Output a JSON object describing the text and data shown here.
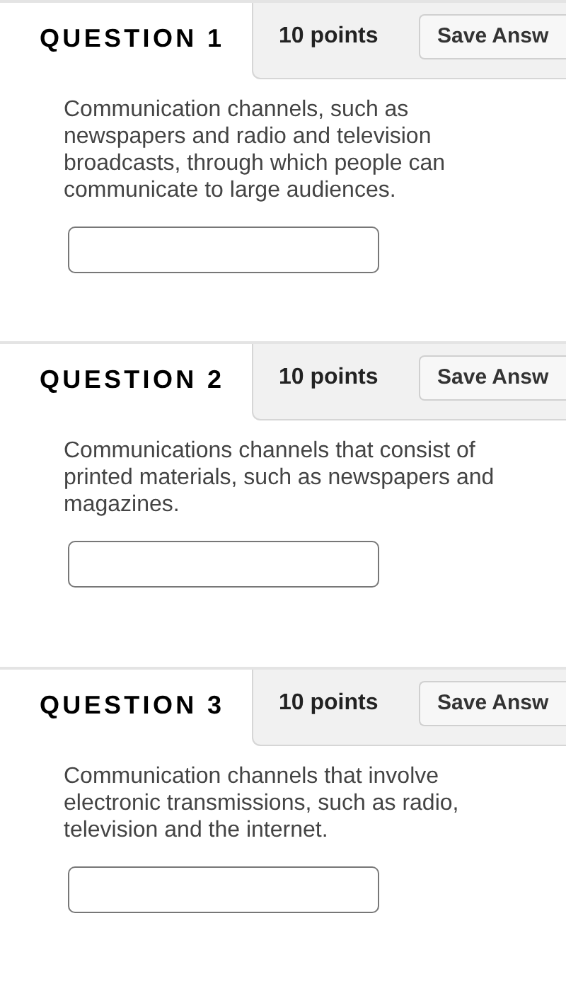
{
  "questions": [
    {
      "title": "QUESTION 1",
      "points": "10 points",
      "save_button": "Save Answ",
      "text": "Communication channels, such as newspapers and radio and television broadcasts, through which people can communicate to large audiences."
    },
    {
      "title": "QUESTION 2",
      "points": "10 points",
      "save_button": "Save Answ",
      "text": "Communications channels that consist of printed materials, such as newspapers and magazines."
    },
    {
      "title": "QUESTION 3",
      "points": "10 points",
      "save_button": "Save Answ",
      "text": "Communication channels that involve electronic transmissions, such as radio, television and the internet."
    }
  ]
}
